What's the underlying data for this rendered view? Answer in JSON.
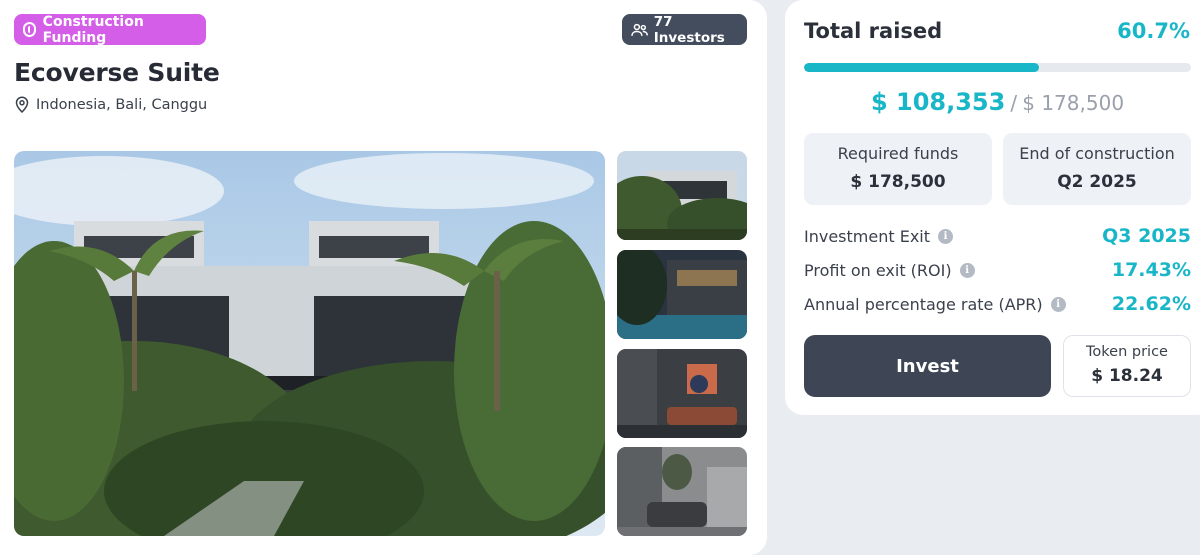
{
  "listing": {
    "category_badge": "Construction Funding",
    "investors_badge": "77 Investors",
    "title": "Ecoverse Suite",
    "location": "Indonesia, Bali, Canggu"
  },
  "funding": {
    "total_raised_label": "Total raised",
    "percent": "60.7%",
    "progress_fraction": 0.607,
    "raised_amount": "$ 108,353",
    "separator": "/",
    "target_amount": "$ 178,500"
  },
  "details": {
    "required_funds_label": "Required funds",
    "required_funds_value": "$ 178,500",
    "end_construction_label": "End of construction",
    "end_construction_value": "Q2 2025"
  },
  "stats": [
    {
      "label": "Investment Exit",
      "value": "Q3 2025"
    },
    {
      "label": "Profit on exit (ROI)",
      "value": "17.43%"
    },
    {
      "label": "Annual percentage rate (APR)",
      "value": "22.62%"
    }
  ],
  "actions": {
    "invest_label": "Invest",
    "token_price_label": "Token price",
    "token_price_value": "$ 18.24"
  },
  "colors": {
    "accent": "#19b6c8",
    "badge_purple": "#d45ee8",
    "dark_button": "#3e4656"
  },
  "icons": {
    "category": "coin-icon",
    "investors": "users-icon",
    "location": "map-pin-icon",
    "info": "info-icon"
  }
}
